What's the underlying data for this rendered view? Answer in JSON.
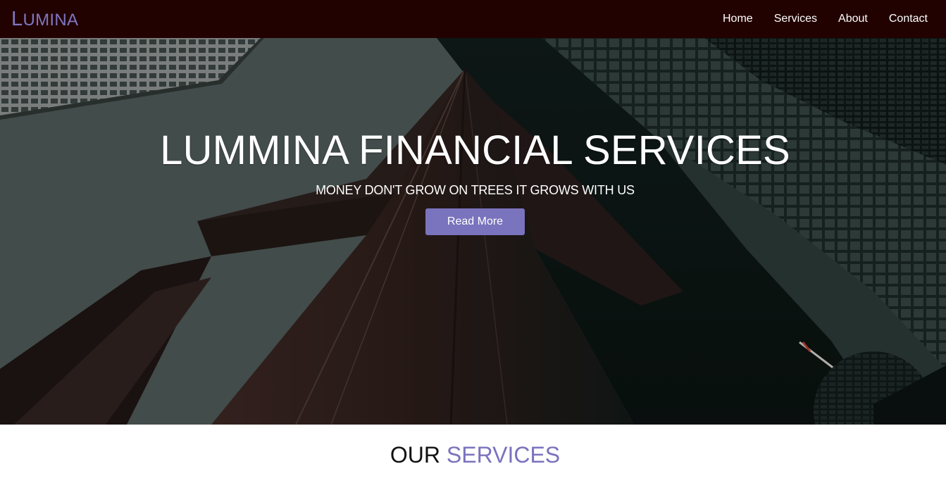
{
  "navbar": {
    "brand_first": "L",
    "brand_rest": "UMINA",
    "links": [
      "Home",
      "Services",
      "About",
      "Contact"
    ]
  },
  "hero": {
    "title": "LUMMINA FINANCIAL SERVICES",
    "subtitle": "MONEY DON'T GROW ON TREES IT GROWS WITH US",
    "button_label": "Read More"
  },
  "services": {
    "heading_plain": "OUR",
    "heading_accent": "SERVICES"
  },
  "colors": {
    "navbar_bg": "#220201",
    "accent": "#7a73bd",
    "hero_sky": "#4c5755"
  }
}
